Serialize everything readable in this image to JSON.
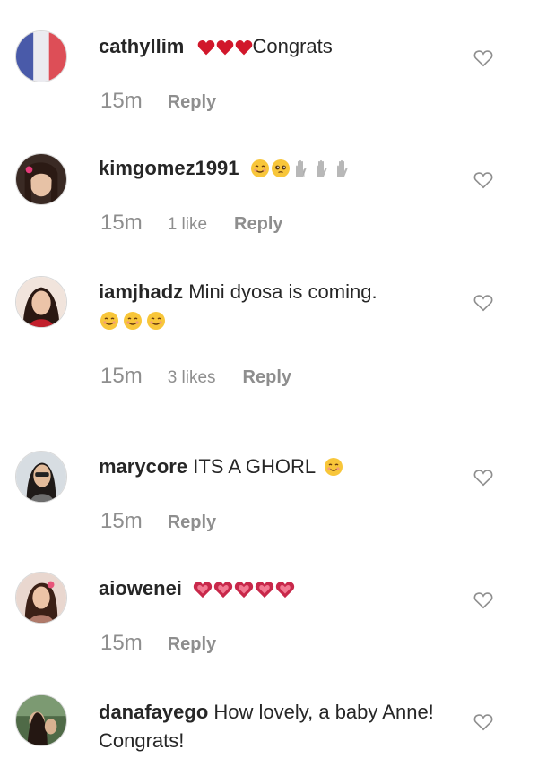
{
  "comments": [
    {
      "username": "cathyllim",
      "emoji_before": [
        "red-heart",
        "red-heart",
        "red-heart"
      ],
      "text": "Congrats",
      "emoji_after": [],
      "time": "15m",
      "likes": "",
      "reply": "Reply"
    },
    {
      "username": "kimgomez1991",
      "emoji_before": [],
      "text": "",
      "emoji_after": [
        "smiling-face",
        "pleading-face",
        "raised-hands",
        "raised-hands",
        "raised-hands"
      ],
      "time": "15m",
      "likes": "1 like",
      "reply": "Reply"
    },
    {
      "username": "iamjhadz",
      "emoji_before": [],
      "text": "Mini dyosa is coming.",
      "emoji_after": [
        "smiling-face",
        "smiling-face",
        "smiling-face"
      ],
      "time": "15m",
      "likes": "3 likes",
      "reply": "Reply"
    },
    {
      "username": "marycore",
      "emoji_before": [],
      "text": "ITS A GHORL",
      "emoji_after": [
        "smiling-face"
      ],
      "time": "15m",
      "likes": "",
      "reply": "Reply"
    },
    {
      "username": "aiowenei",
      "emoji_before": [],
      "text": "",
      "emoji_after": [
        "sparkling-heart",
        "sparkling-heart",
        "sparkling-heart",
        "sparkling-heart",
        "sparkling-heart"
      ],
      "time": "15m",
      "likes": "",
      "reply": "Reply"
    },
    {
      "username": "danafayego",
      "emoji_before": [],
      "text": "How lovely, a baby Anne! Congrats!",
      "emoji_after": [],
      "time": "",
      "likes": "",
      "reply": ""
    }
  ],
  "colors": {
    "username": "#262626",
    "meta": "#8e8e8e",
    "heart_outline": "#8e8e8e",
    "red_heart": "#d1172b"
  }
}
